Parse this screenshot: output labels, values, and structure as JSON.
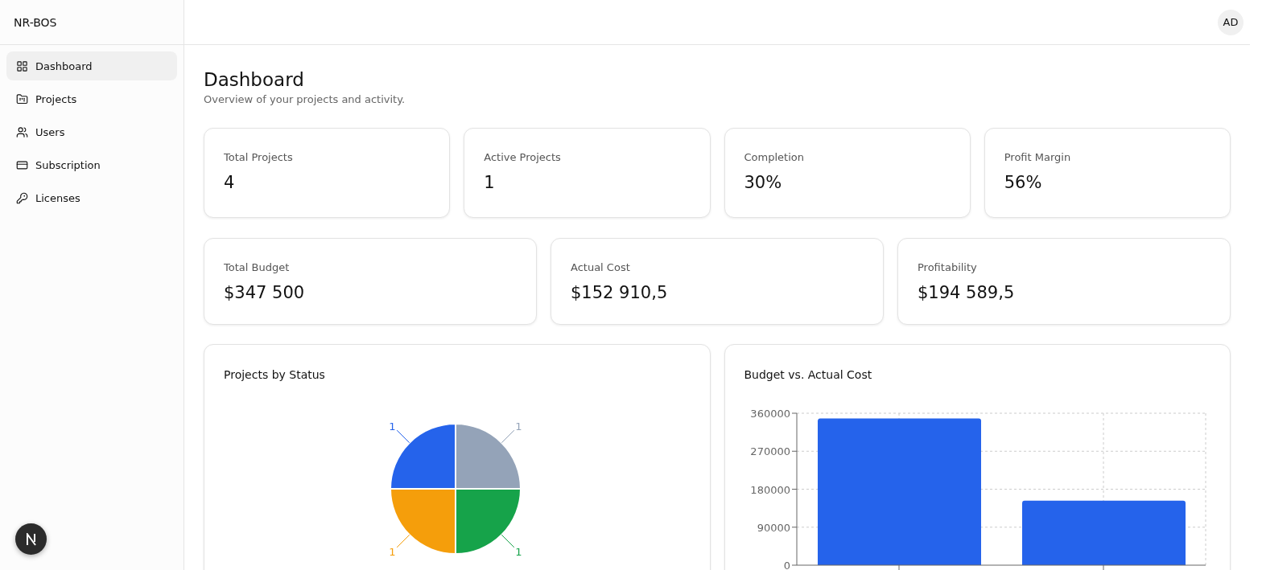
{
  "sidebar": {
    "brand": "NR-BOS",
    "items": [
      {
        "label": "Dashboard",
        "selected": true
      },
      {
        "label": "Projects",
        "selected": false
      },
      {
        "label": "Users",
        "selected": false
      },
      {
        "label": "Subscription",
        "selected": false
      },
      {
        "label": "Licenses",
        "selected": false
      }
    ]
  },
  "header": {
    "avatar": "AD"
  },
  "page": {
    "title": "Dashboard",
    "subtitle": "Overview of your projects and activity."
  },
  "stats_row_1": [
    {
      "label": "Total Projects",
      "value": "4"
    },
    {
      "label": "Active Projects",
      "value": "1"
    },
    {
      "label": "Completion",
      "value": "30%"
    },
    {
      "label": "Profit Margin",
      "value": "56%"
    }
  ],
  "stats_row_2": [
    {
      "label": "Total Budget",
      "value": "$347 500"
    },
    {
      "label": "Actual Cost",
      "value": "$152 910,5"
    },
    {
      "label": "Profitability",
      "value": "$194 589,5"
    }
  ],
  "charts": [
    {
      "title": "Projects by Status",
      "chart_data": {
        "type": "pie",
        "data_labels": true,
        "values": [
          1,
          1,
          1,
          1
        ],
        "colors": [
          "#94a3b8",
          "#16a34a",
          "#f59e0b",
          "#2563eb"
        ]
      }
    },
    {
      "title": "Budget vs. Actual Cost",
      "chart_data": {
        "type": "bar",
        "grid": true,
        "ylim": [
          0,
          360000
        ],
        "yticks": [
          0,
          90000,
          180000,
          270000,
          360000
        ],
        "series": [
          {
            "color": "#2563eb",
            "values": [
              347500,
              152910.5
            ]
          }
        ]
      }
    }
  ]
}
